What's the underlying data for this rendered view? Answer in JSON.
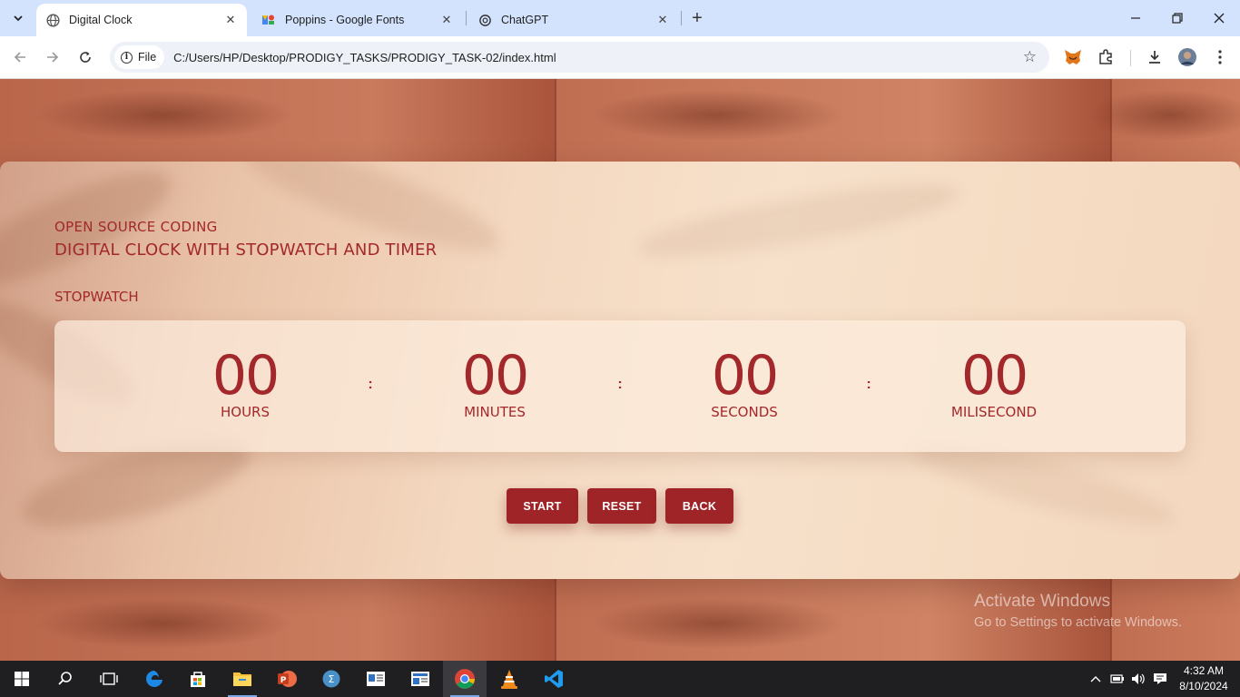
{
  "browser": {
    "tabs": [
      {
        "title": "Digital Clock",
        "favicon": "globe-icon",
        "active": true
      },
      {
        "title": "Poppins - Google Fonts",
        "favicon": "google-fonts-icon",
        "active": false
      },
      {
        "title": "ChatGPT",
        "favicon": "chatgpt-icon",
        "active": false
      }
    ],
    "chip_label": "File",
    "url": "C:/Users/HP/Desktop/PRODIGY_TASKS/PRODIGY_TASK-02/index.html"
  },
  "page": {
    "brand": "OPEN SOURCE CODING",
    "headline": "DIGITAL CLOCK WITH STOPWATCH AND TIMER",
    "section": "STOPWATCH",
    "stopwatch": {
      "hours": {
        "value": "00",
        "label": "HOURS"
      },
      "minutes": {
        "value": "00",
        "label": "MINUTES"
      },
      "seconds": {
        "value": "00",
        "label": "SECONDS"
      },
      "milliseconds": {
        "value": "00",
        "label": "MILISECOND"
      },
      "separator": ":"
    },
    "buttons": {
      "start": "START",
      "reset": "RESET",
      "back": "BACK"
    },
    "accent_color": "#a3282c",
    "button_color": "#9f2427"
  },
  "watermark": {
    "title": "Activate Windows",
    "subtitle": "Go to Settings to activate Windows."
  },
  "taskbar": {
    "apps": [
      "start-icon",
      "search-icon",
      "task-view-icon",
      "edge-icon",
      "store-icon",
      "file-explorer-icon",
      "powerpoint-icon",
      "sql-icon",
      "news-icon",
      "news2-icon",
      "chrome-icon",
      "vlc-icon",
      "vscode-icon"
    ],
    "time": "4:32 AM",
    "date": "8/10/2024"
  }
}
